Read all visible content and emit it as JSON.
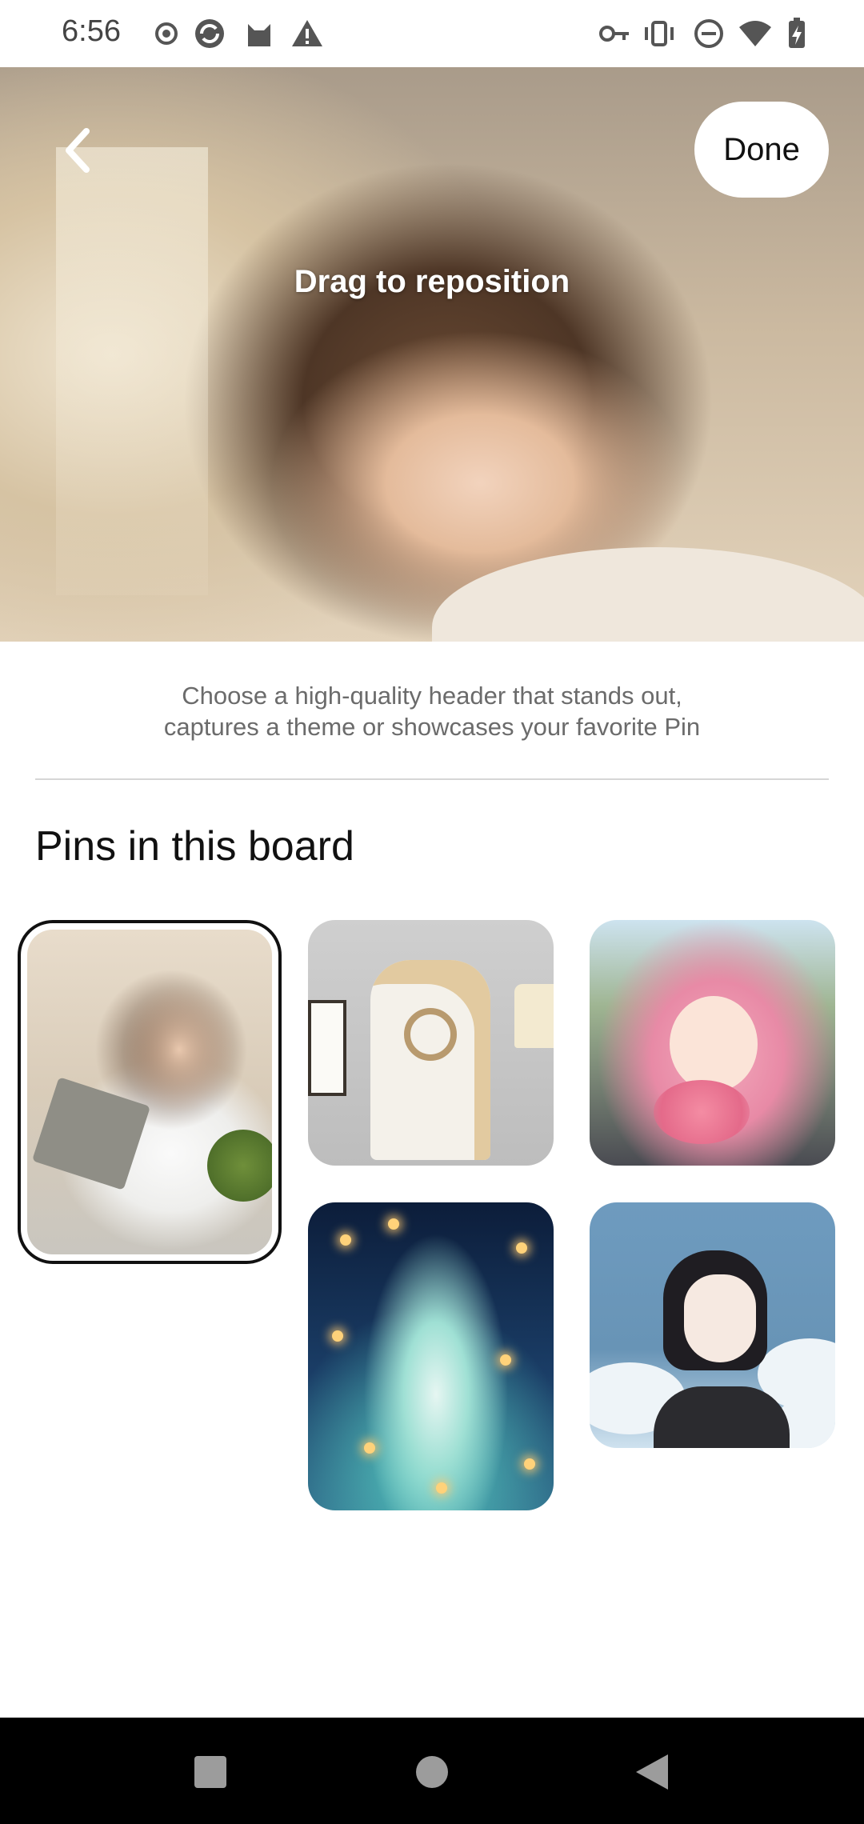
{
  "status_bar": {
    "time": "6:56",
    "left_icons": [
      "radio-button-icon",
      "sync-icon",
      "cat-icon",
      "warning-icon"
    ],
    "right_icons": [
      "vpn-key-icon",
      "vibrate-icon",
      "do-not-disturb-icon",
      "wifi-icon",
      "battery-icon"
    ]
  },
  "header": {
    "drag_hint": "Drag to reposition",
    "done_label": "Done"
  },
  "description": {
    "line1": "Choose a high-quality header that stands out,",
    "line2": "captures a theme or showcases your favorite Pin"
  },
  "section_title": "Pins in this board",
  "pins": [
    {
      "name": "girl-reading-by-window",
      "selected": true
    },
    {
      "name": "white-hoodie-dress",
      "selected": false
    },
    {
      "name": "pink-hair-girl-with-flowers",
      "selected": false
    },
    {
      "name": "princess-with-glowing-butterflies",
      "selected": false
    },
    {
      "name": "short-hair-girl-sky",
      "selected": false
    }
  ],
  "colors": {
    "accent_text": "#111111",
    "description_text": "#6b6b6b",
    "selected_border": "#111111",
    "nav_bar": "#000000"
  }
}
